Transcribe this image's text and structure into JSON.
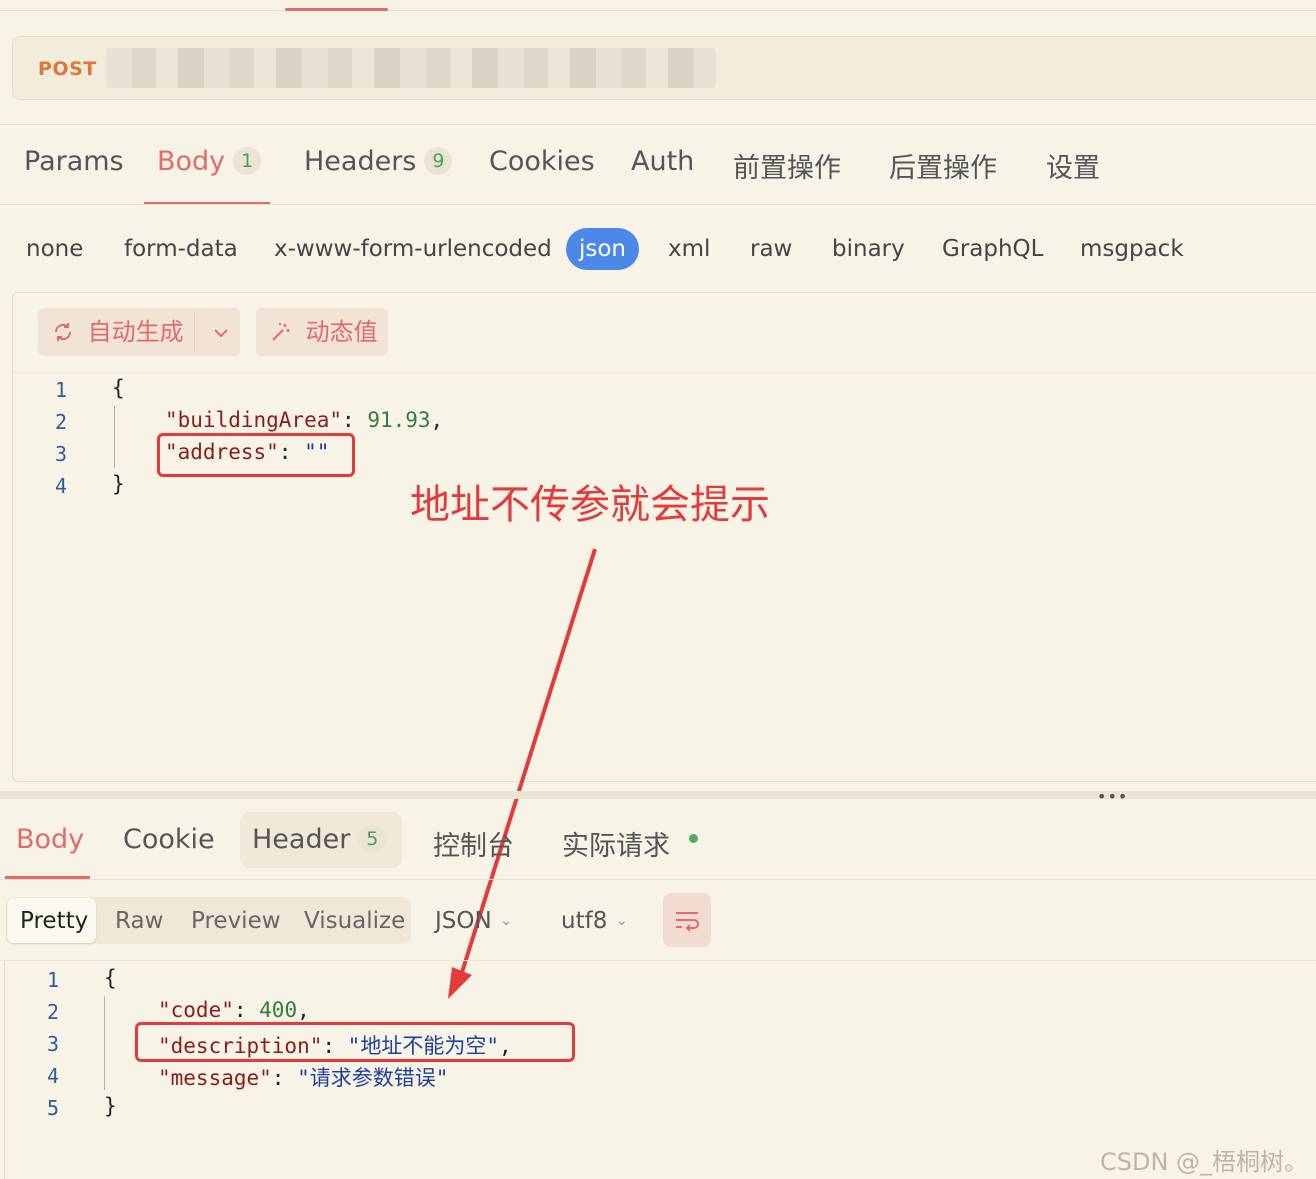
{
  "request": {
    "method": "POST"
  },
  "request_tabs": [
    {
      "label": "Params"
    },
    {
      "label": "Body",
      "badge": "1"
    },
    {
      "label": "Headers",
      "badge": "9"
    },
    {
      "label": "Cookies"
    },
    {
      "label": "Auth"
    },
    {
      "label": "前置操作"
    },
    {
      "label": "后置操作"
    },
    {
      "label": "设置"
    }
  ],
  "body_types": [
    "none",
    "form-data",
    "x-www-form-urlencoded",
    "json",
    "xml",
    "raw",
    "binary",
    "GraphQL",
    "msgpack"
  ],
  "body_type_selected": "json",
  "editor_toolbar": {
    "auto_generate": "自动生成",
    "dynamic_value": "动态值"
  },
  "request_body": {
    "line_numbers": [
      "1",
      "2",
      "3",
      "4"
    ],
    "open_brace": "{",
    "close_brace": "}",
    "k1": "\"buildingArea\"",
    "v1": "91.93",
    "k2": "\"address\"",
    "v2": "\"\""
  },
  "annotation": "地址不传参就会提示",
  "splitter_label": "•••",
  "response_tabs": [
    {
      "label": "Body"
    },
    {
      "label": "Cookie"
    },
    {
      "label": "Header",
      "badge": "5"
    },
    {
      "label": "控制台"
    },
    {
      "label": "实际请求"
    }
  ],
  "view_modes": [
    "Pretty",
    "Raw",
    "Preview",
    "Visualize"
  ],
  "view_mode_selected": "Pretty",
  "format": "JSON",
  "encoding": "utf8",
  "response_body": {
    "line_numbers": [
      "1",
      "2",
      "3",
      "4",
      "5"
    ],
    "open_brace": "{",
    "close_brace": "}",
    "k1": "\"code\"",
    "v1": "400",
    "k2": "\"description\"",
    "v2": "\"地址不能为空\"",
    "k3": "\"message\"",
    "v3": "\"请求参数错误\""
  },
  "watermark": "CSDN @_梧桐树。",
  "colors": {
    "accent": "#e26a6a",
    "json_pill": "#4c88e8",
    "annotation": "#e33b3b",
    "badge_text": "#4a9e5b"
  }
}
